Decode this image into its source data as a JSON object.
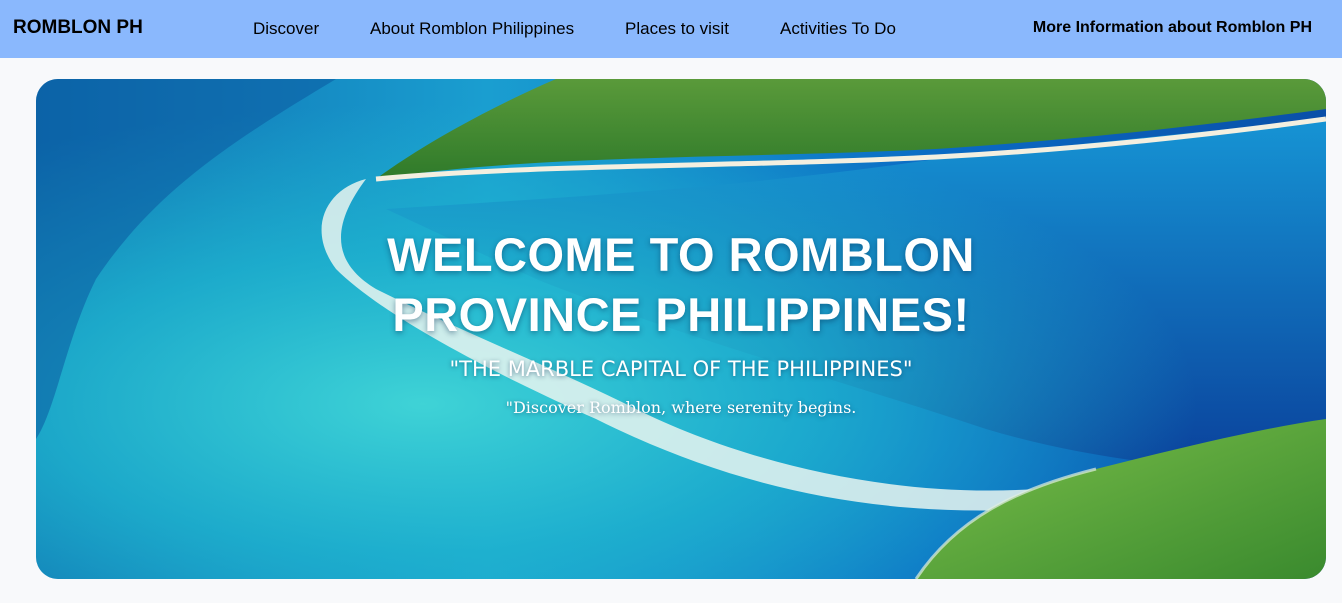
{
  "navbar": {
    "brand": "ROMBLON PH",
    "links": [
      "Discover",
      "About Romblon Philippines",
      "Places to visit",
      "Activities To Do"
    ],
    "more_info": "More Information about Romblon PH",
    "bg_color": "#8ab8fd"
  },
  "hero": {
    "title_line1": "WELCOME TO ROMBLON",
    "title_line2": "PROVINCE PHILIPPINES!",
    "subtitle": "\"THE MARBLE CAPITAL OF THE PHILIPPINES\"",
    "tagline": "\"Discover Romblon, where serenity begins."
  }
}
